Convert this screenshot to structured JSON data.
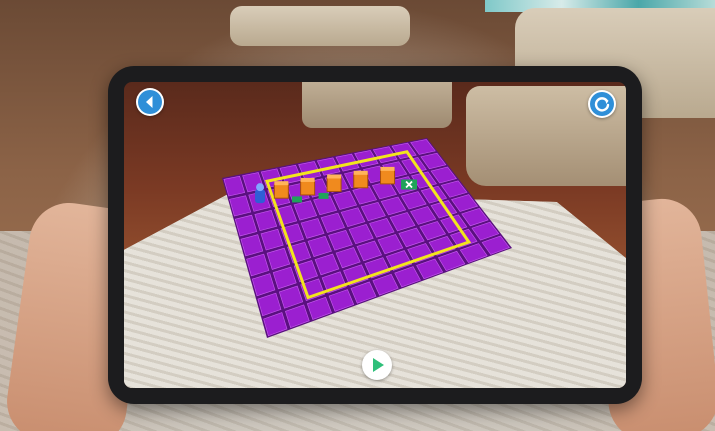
{
  "scene": {
    "description_icons": [
      "sofa",
      "rug",
      "hands",
      "tablet"
    ]
  },
  "app": {
    "controls": {
      "back_icon": "chevron-left-icon",
      "reset_icon": "refresh-icon",
      "play_icon": "play-icon"
    },
    "colors": {
      "button_accent": "#2f8fd8",
      "play_accent": "#2fbf7a",
      "tile_color": "#9b1fd0",
      "border_color": "#f2e51d",
      "block_color": "#f08a1e",
      "goal_color": "#1fa35a",
      "robot_color": "#2f5fd6"
    },
    "board": {
      "rows": 8,
      "cols": 11,
      "path_blocks": 5,
      "goal_marker": "x"
    }
  }
}
